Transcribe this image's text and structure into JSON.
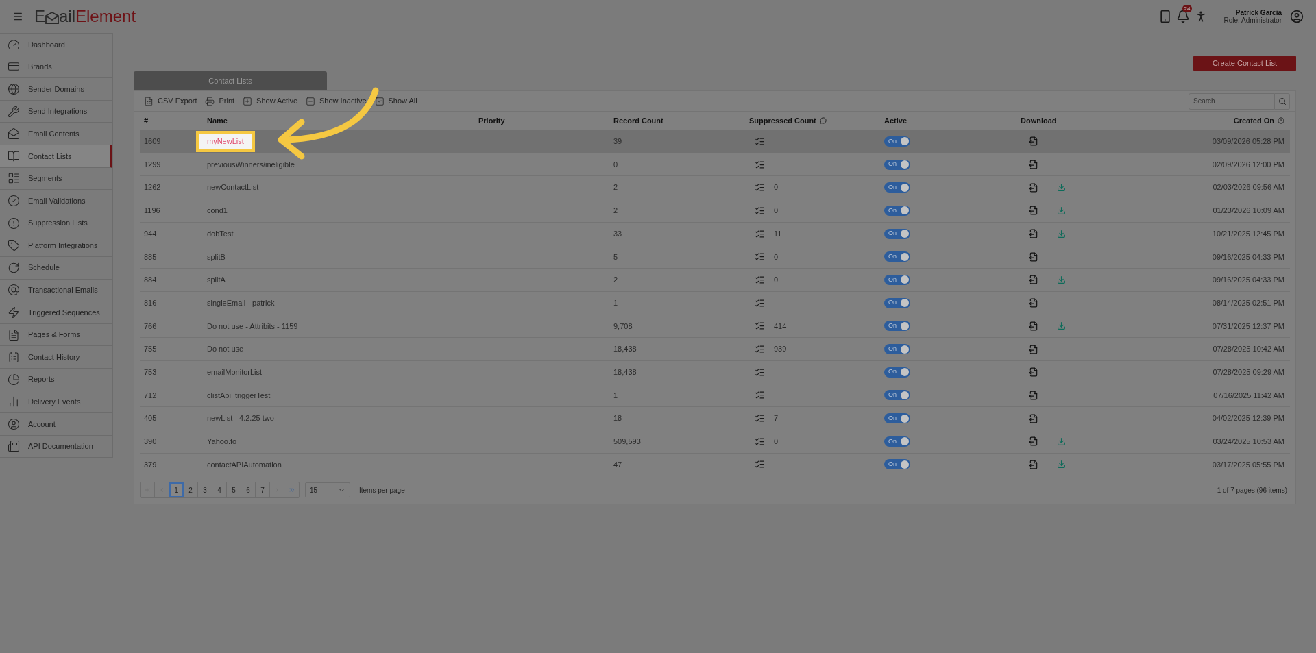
{
  "header": {
    "logo": [
      "E",
      "ail",
      "Element"
    ],
    "notification_count": "24",
    "user_name": "Patrick Garcia",
    "user_role": "Role: Administrator"
  },
  "sidebar": {
    "items": [
      {
        "label": "Dashboard",
        "selected": false
      },
      {
        "label": "Brands",
        "selected": false
      },
      {
        "label": "Sender Domains",
        "selected": false
      },
      {
        "label": "Send Integrations",
        "selected": false
      },
      {
        "label": "Email Contents",
        "selected": false
      },
      {
        "label": "Contact Lists",
        "selected": true
      },
      {
        "label": "Segments",
        "selected": false
      },
      {
        "label": "Email Validations",
        "selected": false
      },
      {
        "label": "Suppression Lists",
        "selected": false
      },
      {
        "label": "Platform Integrations",
        "selected": false
      },
      {
        "label": "Schedule",
        "selected": false
      },
      {
        "label": "Transactional Emails",
        "selected": false
      },
      {
        "label": "Triggered Sequences",
        "selected": false
      },
      {
        "label": "Pages & Forms",
        "selected": false
      },
      {
        "label": "Contact History",
        "selected": false
      },
      {
        "label": "Reports",
        "selected": false
      },
      {
        "label": "Delivery Events",
        "selected": false
      },
      {
        "label": "Account",
        "selected": false
      },
      {
        "label": "API Documentation",
        "selected": false
      }
    ]
  },
  "create_button": "Create Contact List",
  "tab": "Contact Lists",
  "toolbar": [
    "CSV Export",
    "Print",
    "Show Active",
    "Show Inactive",
    "Show All"
  ],
  "search": {
    "placeholder": "Search"
  },
  "table": {
    "columns": [
      "#",
      "Name",
      "Priority",
      "Record Count",
      "Suppressed Count",
      "Active",
      "Download",
      "Created On"
    ],
    "rows": [
      {
        "id": "1609",
        "name": "myNewList",
        "highlighted": true,
        "selected": true,
        "records": "39",
        "suppressed": "",
        "active": true,
        "toggle": "On",
        "download": false,
        "created": "03/09/2026 05:28 PM"
      },
      {
        "id": "1299",
        "name": "previousWinners/ineligible",
        "highlighted": false,
        "selected": false,
        "records": "0",
        "suppressed": "",
        "active": true,
        "toggle": "On",
        "download": false,
        "created": "02/09/2026 12:00 PM"
      },
      {
        "id": "1262",
        "name": "newContactList",
        "highlighted": false,
        "selected": false,
        "records": "2",
        "suppressed": "0",
        "active": true,
        "toggle": "On",
        "download": true,
        "created": "02/03/2026 09:56 AM"
      },
      {
        "id": "1196",
        "name": "cond1",
        "highlighted": false,
        "selected": false,
        "records": "2",
        "suppressed": "0",
        "active": true,
        "toggle": "On",
        "download": true,
        "created": "01/23/2026 10:09 AM"
      },
      {
        "id": "944",
        "name": "dobTest",
        "highlighted": false,
        "selected": false,
        "records": "33",
        "suppressed": "11",
        "active": true,
        "toggle": "On",
        "download": true,
        "created": "10/21/2025 12:45 PM"
      },
      {
        "id": "885",
        "name": "splitB",
        "highlighted": false,
        "selected": false,
        "records": "5",
        "suppressed": "0",
        "active": true,
        "toggle": "On",
        "download": false,
        "created": "09/16/2025 04:33 PM"
      },
      {
        "id": "884",
        "name": "splitA",
        "highlighted": false,
        "selected": false,
        "records": "2",
        "suppressed": "0",
        "active": true,
        "toggle": "On",
        "download": true,
        "created": "09/16/2025 04:33 PM"
      },
      {
        "id": "816",
        "name": "singleEmail - patrick",
        "highlighted": false,
        "selected": false,
        "records": "1",
        "suppressed": "",
        "active": true,
        "toggle": "On",
        "download": false,
        "created": "08/14/2025 02:51 PM"
      },
      {
        "id": "766",
        "name": "Do not use - Attribits - 1159",
        "highlighted": false,
        "selected": false,
        "records": "9,708",
        "suppressed": "414",
        "active": true,
        "toggle": "On",
        "download": true,
        "created": "07/31/2025 12:37 PM"
      },
      {
        "id": "755",
        "name": "Do not use",
        "highlighted": false,
        "selected": false,
        "records": "18,438",
        "suppressed": "939",
        "active": true,
        "toggle": "On",
        "download": false,
        "created": "07/28/2025 10:42 AM"
      },
      {
        "id": "753",
        "name": "emailMonitorList",
        "highlighted": false,
        "selected": false,
        "records": "18,438",
        "suppressed": "",
        "active": true,
        "toggle": "On",
        "download": false,
        "created": "07/28/2025 09:29 AM"
      },
      {
        "id": "712",
        "name": "clistApi_triggerTest",
        "highlighted": false,
        "selected": false,
        "records": "1",
        "suppressed": "",
        "active": true,
        "toggle": "On",
        "download": false,
        "created": "07/16/2025 11:42 AM"
      },
      {
        "id": "405",
        "name": "newList - 4.2.25 two",
        "highlighted": false,
        "selected": false,
        "records": "18",
        "suppressed": "7",
        "active": true,
        "toggle": "On",
        "download": false,
        "created": "04/02/2025 12:39 PM"
      },
      {
        "id": "390",
        "name": "Yahoo.fo",
        "highlighted": false,
        "selected": false,
        "records": "509,593",
        "suppressed": "0",
        "active": true,
        "toggle": "On",
        "download": true,
        "created": "03/24/2025 10:53 AM"
      },
      {
        "id": "379",
        "name": "contactAPIAutomation",
        "highlighted": false,
        "selected": false,
        "records": "47",
        "suppressed": "",
        "active": true,
        "toggle": "On",
        "download": true,
        "created": "03/17/2025 05:55 PM"
      }
    ]
  },
  "pagination": {
    "pages": [
      {
        "label": "1",
        "selected": true
      },
      {
        "label": "2",
        "selected": false
      },
      {
        "label": "3",
        "selected": false
      },
      {
        "label": "4",
        "selected": false
      },
      {
        "label": "5",
        "selected": false
      },
      {
        "label": "6",
        "selected": false
      },
      {
        "label": "7",
        "selected": false
      }
    ],
    "page_size": "15",
    "page_size_label": "Items per page",
    "summary": "1 of 7 pages (96 items)"
  }
}
